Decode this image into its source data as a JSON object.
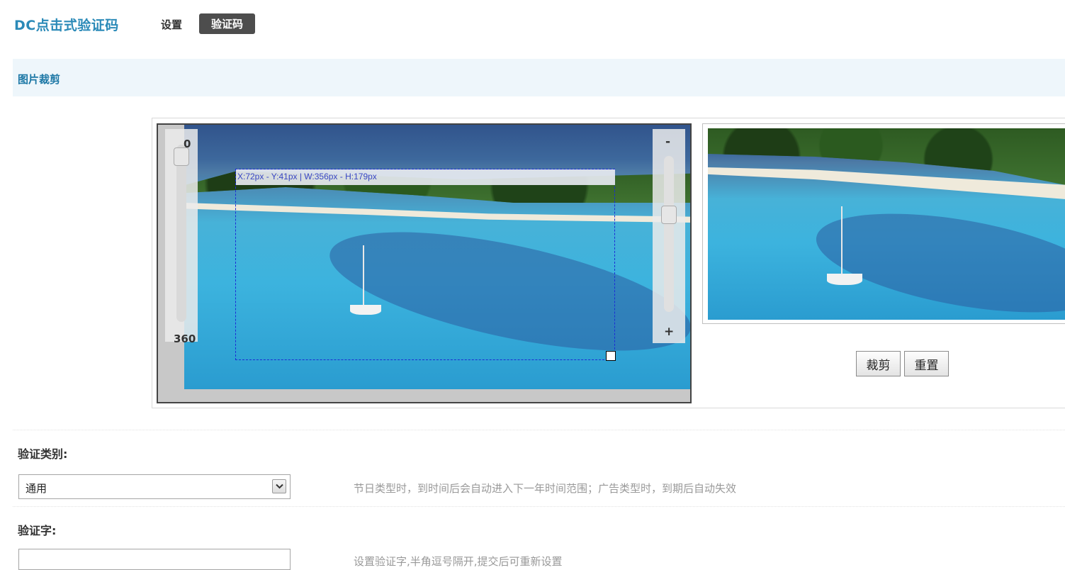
{
  "header": {
    "app_title": "DC点击式验证码",
    "tabs": [
      {
        "label": "设置",
        "active": false
      },
      {
        "label": "验证码",
        "active": true
      }
    ]
  },
  "section": {
    "title": "图片裁剪"
  },
  "cropper": {
    "rotate_min": "0",
    "rotate_max": "360",
    "zoom_out": "-",
    "zoom_in": "+",
    "selection_info": "X:72px - Y:41px | W:356px - H:179px"
  },
  "buttons": {
    "crop": "裁剪",
    "reset": "重置"
  },
  "form": {
    "type_label": "验证类别:",
    "type_value": "通用",
    "type_hint": "节日类型时，到时间后会自动进入下一年时间范围；广告类型时，到期后自动失效",
    "word_label": "验证字:",
    "word_value": "",
    "word_hint": "设置验证字,半角逗号隔开,提交后可重新设置"
  },
  "colors": {
    "accent": "#2b8ab8",
    "active_tab_bg": "#4d4d4d",
    "section_bg": "#eef6fb",
    "crop_border": "#1a2bd6"
  }
}
